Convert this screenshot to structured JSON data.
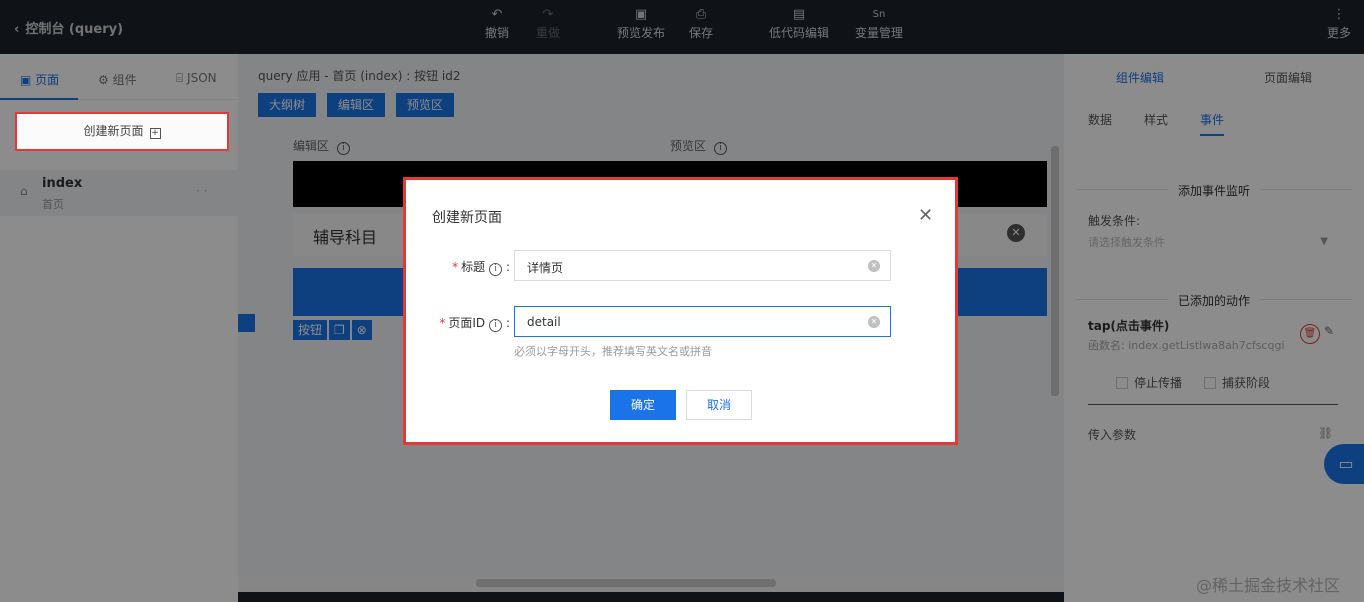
{
  "topbar": {
    "back_label": "控制台 (query)",
    "tools": [
      {
        "icon": "undo-icon",
        "glyph": "↶",
        "label": "撤销"
      },
      {
        "icon": "redo-icon",
        "glyph": "↷",
        "label": "重做"
      },
      {
        "icon": "preview-icon",
        "glyph": "▣",
        "label": "预览发布"
      },
      {
        "icon": "save-icon",
        "glyph": "💾",
        "label": "保存"
      },
      {
        "icon": "lowcode-icon",
        "glyph": "▤",
        "label": "低代码编辑"
      },
      {
        "icon": "variable-icon",
        "glyph": "Sn",
        "label": "变量管理"
      },
      {
        "icon": "more-icon",
        "glyph": "⋮",
        "label": "更多"
      }
    ]
  },
  "left": {
    "tabs": [
      {
        "icon": "page-icon",
        "glyph": "▣",
        "label": "页面"
      },
      {
        "icon": "component-icon",
        "glyph": "⚙",
        "label": "组件"
      },
      {
        "icon": "json-icon",
        "glyph": "⌸",
        "label": "JSON"
      }
    ],
    "create_label": "创建新页面",
    "page_item": {
      "name": "index",
      "sub": "首页"
    }
  },
  "center": {
    "breadcrumb": "query 应用 - 首页 (index) : 按钮 id2",
    "buttons": [
      "大纲树",
      "编辑区",
      "预览区"
    ],
    "edit_label": "编辑区",
    "preview_label": "预览区",
    "subject": "辅导科目",
    "tags": [
      "按钮"
    ]
  },
  "right": {
    "tabs": [
      "组件编辑",
      "页面编辑"
    ],
    "subtabs": [
      "数据",
      "样式",
      "事件"
    ],
    "add_listener": "添加事件监听",
    "trigger_label": "触发条件:",
    "trigger_placeholder": "请选择触发条件",
    "added_actions": "已添加的动作",
    "event_name": "tap(点击事件)",
    "event_value": "函数名: index.getListIwa8ah7cfscqgi",
    "stop_propagation": "停止传播",
    "capture_phase": "捕获阶段",
    "params_label": "传入参数"
  },
  "modal": {
    "title": "创建新页面",
    "title_label": "标题",
    "title_value": "详情页",
    "id_label": "页面ID",
    "id_value": "detail",
    "hint": "必须以字母开头，推荐填写英文名或拼音",
    "ok": "确定",
    "cancel": "取消"
  },
  "watermark": "@稀土掘金技术社区",
  "colors": {
    "accent": "#1a73e8",
    "danger": "#e53935",
    "topbar": "#1d232d"
  }
}
